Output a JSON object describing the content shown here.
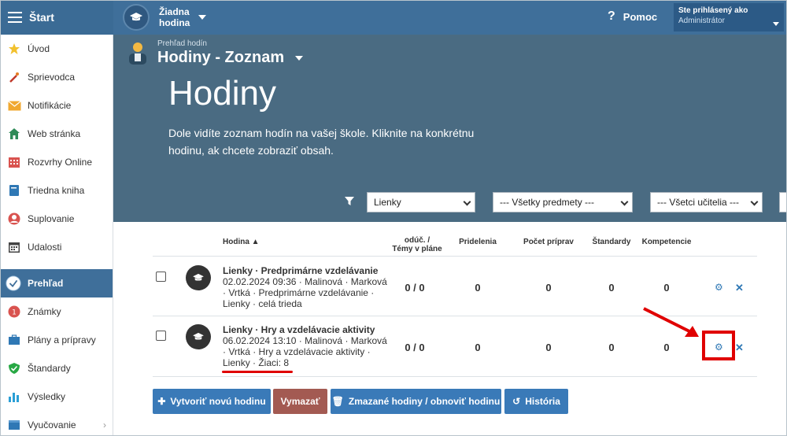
{
  "topbar": {
    "start_label": "Štart",
    "no_lesson_label": "Žiadna hodina",
    "help_label": "Pomoc",
    "user_line1": "Ste prihlásený ako",
    "user_line2": "Administrátor"
  },
  "sidebar": {
    "items": [
      {
        "label": "Úvod",
        "icon": "star-icon"
      },
      {
        "label": "Sprievodca",
        "icon": "magic-wand-icon"
      },
      {
        "label": "Notifikácie",
        "icon": "envelope-icon"
      },
      {
        "label": "Web stránka",
        "icon": "home-icon"
      },
      {
        "label": "Rozvrhy Online",
        "icon": "calendar-grid-icon"
      },
      {
        "label": "Triedna kniha",
        "icon": "book-icon"
      },
      {
        "label": "Suplovanie",
        "icon": "person-icon"
      },
      {
        "label": "Udalosti",
        "icon": "calendar-icon"
      },
      {
        "label": "Prehľad",
        "icon": "check-circle-icon",
        "active": true
      },
      {
        "label": "Známky",
        "icon": "grade-icon"
      },
      {
        "label": "Plány a prípravy",
        "icon": "briefcase-icon"
      },
      {
        "label": "Štandardy",
        "icon": "shield-check-icon"
      },
      {
        "label": "Výsledky",
        "icon": "bar-chart-icon"
      },
      {
        "label": "Vyučovanie",
        "icon": "box-icon"
      }
    ]
  },
  "header": {
    "crumb_small": "Prehľad hodín",
    "crumb_title": "Hodiny - Zoznam",
    "title": "Hodiny",
    "description": "Dole vidíte zoznam hodín na vašej škole. Kliknite na konkrétnu hodinu, ak chcete zobraziť obsah."
  },
  "filters": {
    "class_value": "Lienky",
    "subject_value": "--- Všetky predmety ---",
    "teacher_value": "--- Všetci učitelia ---"
  },
  "table": {
    "headers": {
      "lesson": "Hodina ▲",
      "taught_1": "odúč. /",
      "taught_2": "Témy v pláne",
      "assignments": "Pridelenia",
      "preparations": "Počet príprav",
      "standards": "Štandardy",
      "competences": "Kompetencie"
    },
    "rows": [
      {
        "title": "Lienky · Predprimárne vzdelávanie",
        "detail_1": "02.02.2024 09:36 · Malinová · Marková",
        "detail_2": "· Vrtká · Predprimárne vzdelávanie ·",
        "detail_3": "Lienky · celá trieda",
        "taught": "0 / 0",
        "assignments": "0",
        "preparations": "0",
        "standards": "0",
        "competences": "0"
      },
      {
        "title": "Lienky · Hry a vzdelávacie aktivity",
        "detail_1": "06.02.2024 13:10 · Malinová · Marková",
        "detail_2": "· Vrtká · Hry a vzdelávacie aktivity ·",
        "detail_3": "Lienky · Žiaci: 8",
        "taught": "0 / 0",
        "assignments": "0",
        "preparations": "0",
        "standards": "0",
        "competences": "0"
      }
    ]
  },
  "buttons": {
    "create": "Vytvoriť novú hodinu",
    "delete": "Vymazať",
    "deleted": "Zmazané hodiny / obnoviť hodinu",
    "history": "História"
  },
  "colors": {
    "topbar": "#3f6f9a",
    "hero": "#4a6b82",
    "button_blue": "#3a7ab8",
    "button_red": "#a35a52",
    "annotation_red": "#e00000"
  }
}
